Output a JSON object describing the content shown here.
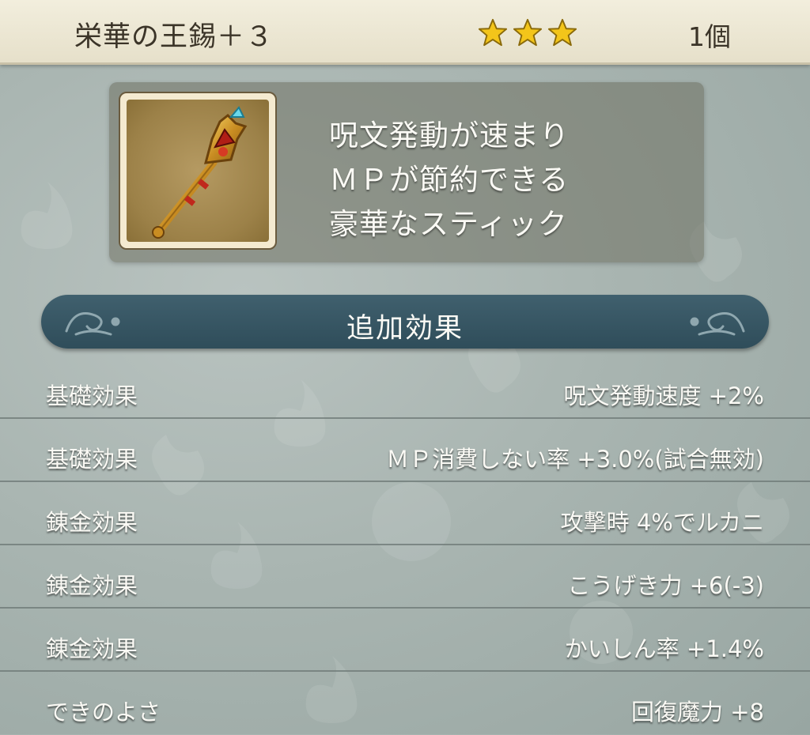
{
  "header": {
    "item_name": "栄華の王錫＋３",
    "star_count": 3,
    "count_label": "1個"
  },
  "description": {
    "lines": [
      "呪文発動が速まり",
      "ＭＰが節約できる",
      "豪華なスティック"
    ]
  },
  "section": {
    "title": "追加効果"
  },
  "effects": [
    {
      "label": "基礎効果",
      "value": "呪文発動速度  +2%"
    },
    {
      "label": "基礎効果",
      "value": "ＭＰ消費しない率  +3.0%(試合無効)"
    },
    {
      "label": "錬金効果",
      "value": "攻撃時  4%でルカニ"
    },
    {
      "label": "錬金効果",
      "value": "こうげき力  +6(-3)"
    },
    {
      "label": "錬金効果",
      "value": "かいしん率  +1.4%"
    },
    {
      "label": "できのよさ",
      "value": "回復魔力  +8"
    }
  ],
  "colors": {
    "star": "#f3c51a",
    "banner": "#35525f",
    "header_bg": "#efeada"
  },
  "icons": {
    "item": "scepter-icon",
    "star": "star-icon",
    "ornament": "swirl-ornament-icon"
  }
}
